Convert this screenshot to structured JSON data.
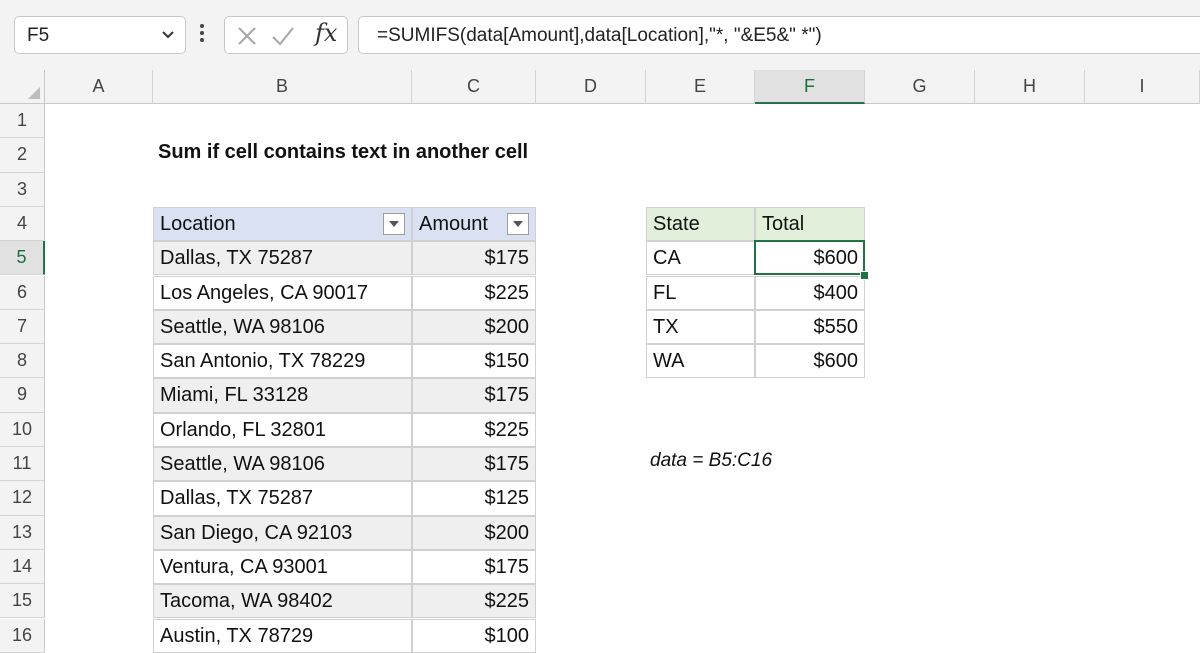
{
  "name_box": {
    "value": "F5"
  },
  "formula_bar": {
    "formula": "=SUMIFS(data[Amount],data[Location],\"*, \"&E5&\" *\")"
  },
  "columns": [
    "A",
    "B",
    "C",
    "D",
    "E",
    "F",
    "G",
    "H",
    "I"
  ],
  "rows": [
    "1",
    "2",
    "3",
    "4",
    "5",
    "6",
    "7",
    "8",
    "9",
    "10",
    "11",
    "12",
    "13",
    "14",
    "15",
    "16"
  ],
  "active": {
    "column": "F",
    "row": "5"
  },
  "sheet": {
    "title": "Sum if cell contains text in another cell",
    "data_table": {
      "headers": [
        "Location",
        "Amount"
      ],
      "rows": [
        [
          "Dallas, TX 75287",
          "$175"
        ],
        [
          "Los Angeles, CA 90017",
          "$225"
        ],
        [
          "Seattle, WA 98106",
          "$200"
        ],
        [
          "San Antonio, TX 78229",
          "$150"
        ],
        [
          "Miami, FL 33128",
          "$175"
        ],
        [
          "Orlando, FL 32801",
          "$225"
        ],
        [
          "Seattle, WA 98106",
          "$175"
        ],
        [
          "Dallas, TX 75287",
          "$125"
        ],
        [
          "San Diego, CA 92103",
          "$200"
        ],
        [
          "Ventura, CA 93001",
          "$175"
        ],
        [
          "Tacoma, WA 98402",
          "$225"
        ],
        [
          "Austin, TX 78729",
          "$100"
        ]
      ]
    },
    "summary_table": {
      "headers": [
        "State",
        "Total"
      ],
      "rows": [
        [
          "CA",
          "$600"
        ],
        [
          "FL",
          "$400"
        ],
        [
          "TX",
          "$550"
        ],
        [
          "WA",
          "$600"
        ]
      ]
    },
    "note": "data = B5:C16"
  },
  "colors": {
    "accent": "#217346",
    "table_header_blue": "#d9e1f2",
    "table_header_green": "#e2efda"
  }
}
